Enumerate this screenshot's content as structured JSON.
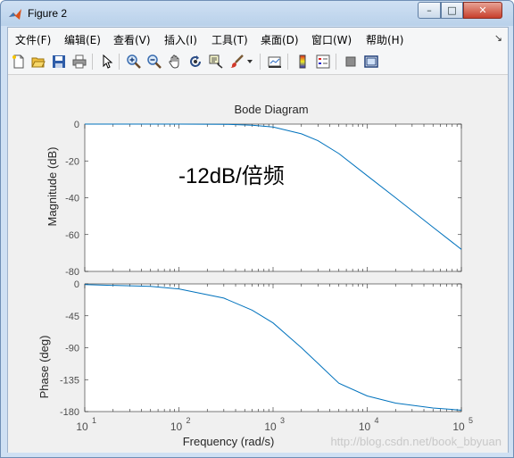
{
  "window": {
    "title": "Figure 2",
    "minimize": "–",
    "maximize": "□",
    "close": "✕"
  },
  "menu": {
    "items": [
      {
        "label": "文件(F)"
      },
      {
        "label": "编辑(E)"
      },
      {
        "label": "查看(V)"
      },
      {
        "label": "插入(I)"
      },
      {
        "label": "工具(T)"
      },
      {
        "label": "桌面(D)"
      },
      {
        "label": "窗口(W)"
      },
      {
        "label": "帮助(H)"
      }
    ],
    "overflow": "↘"
  },
  "toolbar": {
    "icons": [
      "new-figure-icon",
      "open-icon",
      "save-icon",
      "print-icon",
      "pointer-icon",
      "zoom-in-icon",
      "zoom-out-icon",
      "pan-hand-icon",
      "rotate-3d-icon",
      "data-cursor-icon",
      "brush-icon",
      "brush-dropdown-icon",
      "link-plot-icon",
      "colorbar-icon",
      "legend-icon",
      "hide-plot-tools-icon",
      "show-plot-tools-icon"
    ]
  },
  "plot": {
    "title": "Bode Diagram",
    "annotation": "-12dB/倍频",
    "watermark": "http://blog.csdn.net/book_bbyuan",
    "magnitude": {
      "ylabel": "Magnitude (dB)",
      "yticks": [
        "0",
        "-20",
        "-40",
        "-60",
        "-80"
      ],
      "ylim": [
        -80,
        0
      ]
    },
    "phase": {
      "ylabel": "Phase (deg)",
      "yticks": [
        "0",
        "-45",
        "-90",
        "-135",
        "-180"
      ],
      "ylim": [
        -180,
        0
      ]
    },
    "xlabel": "Frequency  (rad/s)",
    "xticks": [
      {
        "base": "10",
        "exp": "1"
      },
      {
        "base": "10",
        "exp": "2"
      },
      {
        "base": "10",
        "exp": "3"
      },
      {
        "base": "10",
        "exp": "4"
      },
      {
        "base": "10",
        "exp": "5"
      }
    ],
    "xlim": [
      10,
      100000
    ],
    "line_color": "#0072bd"
  },
  "chart_data": [
    {
      "type": "line",
      "title": "Bode Diagram",
      "xlabel": "Frequency  (rad/s)",
      "ylabel": "Magnitude (dB)",
      "x_scale": "log",
      "xlim": [
        10,
        100000
      ],
      "ylim": [
        -80,
        0
      ],
      "grid": false,
      "x": [
        10,
        100,
        300,
        600,
        1000,
        2000,
        3000,
        5000,
        10000,
        20000,
        50000,
        100000
      ],
      "y": [
        0,
        0,
        -0.1,
        -0.6,
        -1.6,
        -5.3,
        -9.0,
        -16,
        -28,
        -40,
        -56,
        -68
      ]
    },
    {
      "type": "line",
      "xlabel": "Frequency  (rad/s)",
      "ylabel": "Phase (deg)",
      "x_scale": "log",
      "xlim": [
        10,
        100000
      ],
      "ylim": [
        -180,
        0
      ],
      "grid": false,
      "x": [
        10,
        50,
        100,
        300,
        600,
        1000,
        2000,
        3000,
        5000,
        10000,
        20000,
        50000,
        100000
      ],
      "y": [
        -1,
        -3.5,
        -7,
        -20,
        -37,
        -55,
        -90,
        -112,
        -140,
        -158,
        -168,
        -175,
        -178
      ]
    }
  ]
}
